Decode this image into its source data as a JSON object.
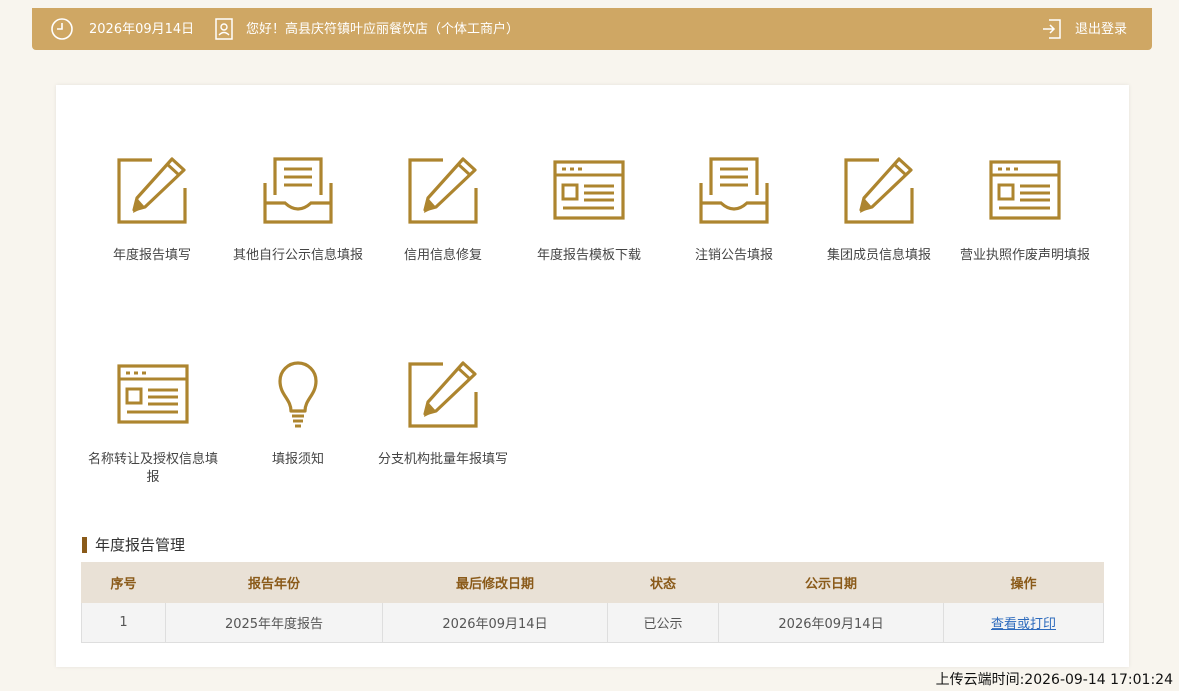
{
  "header": {
    "date": "2026年09月14日",
    "greeting": "您好！高县庆符镇叶应丽餐饮店（个体工商户）",
    "logout_label": "退出登录"
  },
  "colors": {
    "brand": "#cfa764",
    "icon": "#ad852f",
    "accent": "#8a5a19",
    "link": "#2e6bbd"
  },
  "tiles": [
    {
      "label": "年度报告填写",
      "icon": "edit-pencil-icon"
    },
    {
      "label": "其他自行公示信息填报",
      "icon": "inbox-tray-icon"
    },
    {
      "label": "信用信息修复",
      "icon": "edit-pencil-icon"
    },
    {
      "label": "年度报告模板下载",
      "icon": "browser-window-icon"
    },
    {
      "label": "注销公告填报",
      "icon": "inbox-tray-icon"
    },
    {
      "label": "集团成员信息填报",
      "icon": "edit-pencil-icon"
    },
    {
      "label": "营业执照作废声明填报",
      "icon": "browser-window-icon"
    },
    {
      "label": "名称转让及授权信息填报",
      "icon": "browser-window-icon"
    },
    {
      "label": "填报须知",
      "icon": "lightbulb-icon"
    },
    {
      "label": "分支机构批量年报填写",
      "icon": "edit-pencil-icon"
    }
  ],
  "annual_report": {
    "title": "年度报告管理",
    "columns": [
      "序号",
      "报告年份",
      "最后修改日期",
      "状态",
      "公示日期",
      "操作"
    ],
    "rows": [
      {
        "index": "1",
        "year": "2025年年度报告",
        "modified": "2026年09月14日",
        "status": "已公示",
        "published": "2026年09月14日",
        "action": "查看或打印"
      }
    ]
  },
  "footer": {
    "upload_time": "上传云端时间:2026-09-14 17:01:24"
  }
}
